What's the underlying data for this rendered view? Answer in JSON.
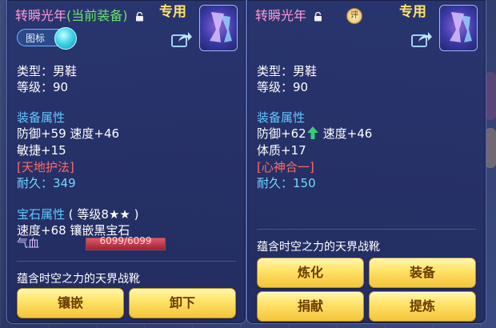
{
  "left": {
    "name": "转瞬光年",
    "tag": "(当前装备)",
    "badge": "专用",
    "toggle_label": "图标",
    "type": "类型：男鞋",
    "level": "等级：90",
    "attr_head": "装备属性",
    "attr1": "防御+59 速度+46",
    "attr2": "敏捷+15",
    "skill": "[天地护法]",
    "durability_label": "耐久：",
    "durability": "349",
    "gem_head": "宝石属性",
    "gem_level": "( 等级8★★ )",
    "gem_attr": "速度+68 镶嵌黑宝石",
    "hp_label": "气血",
    "hp_value": "6099/6099",
    "hp_fill": 1.0,
    "desc": "蕴含时空之力的天界战靴",
    "buttons": [
      "镶嵌",
      "卸下"
    ]
  },
  "right": {
    "name": "转瞬光年",
    "badge": "专用",
    "review": "评",
    "type": "类型：男鞋",
    "level": "等级：90",
    "attr_head": "装备属性",
    "attr1a": "防御+62",
    "attr1b": "速度+46",
    "attr2": "体质+17",
    "skill": "[心神合一]",
    "durability_label": "耐久：",
    "durability": "150",
    "desc": "蕴含时空之力的天界战靴",
    "buttons": [
      "炼化",
      "装备",
      "捐献",
      "提炼"
    ]
  },
  "colors": {
    "title": "#ff9ad8",
    "current_tag": "#6ee06e",
    "section": "#62c8ff",
    "skill": "#ff6a6a",
    "durability": "#74d6ff",
    "button": "#ffe46a",
    "up_arrow": "#33d07a"
  },
  "icons": [
    "lock-icon",
    "share-icon",
    "boots-item-icon",
    "review-icon",
    "up-arrow-icon"
  ]
}
